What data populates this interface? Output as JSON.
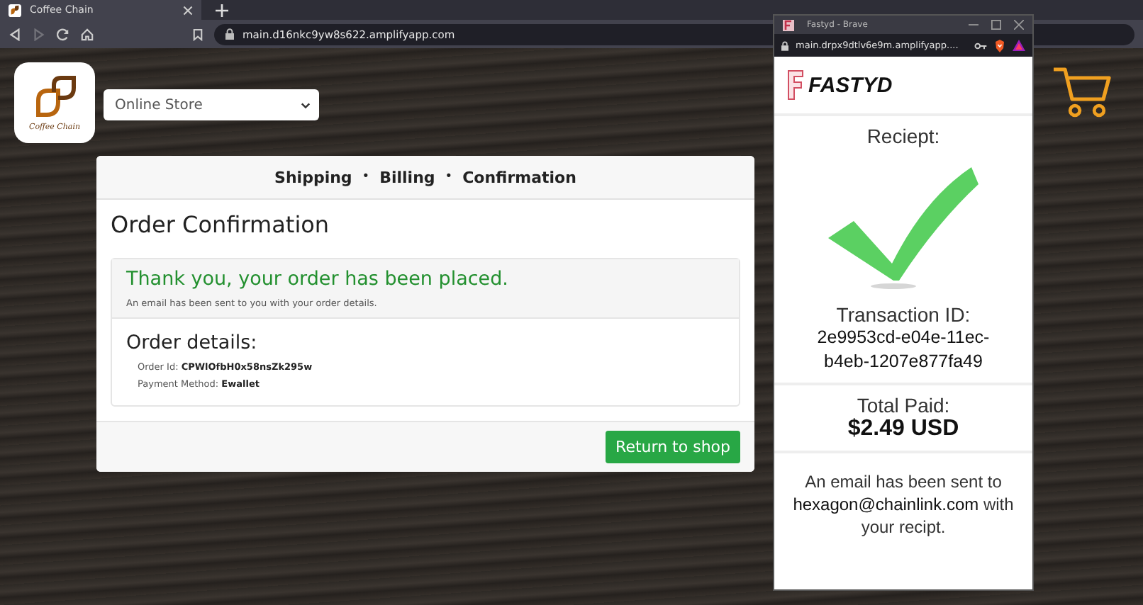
{
  "browser": {
    "tabs": [
      {
        "label": "Coffee Chain",
        "selected": true
      }
    ],
    "url": "main.d16nkc9yw8s622.amplifyapp.com",
    "forward_disabled": true
  },
  "page": {
    "logo_text": "Coffee Chain",
    "store_select": {
      "value": "Online Store"
    },
    "checkout": {
      "steps": [
        {
          "label": "Shipping"
        },
        {
          "label": "Billing"
        },
        {
          "label": "Confirmation"
        }
      ],
      "separator": "•",
      "title": "Order Confirmation",
      "success_title": "Thank you, your order has been placed.",
      "success_note": "An email has been sent to you with your order details.",
      "details_title": "Order details:",
      "details": [
        "Order Id: **CPWlOfbH0x58nsZk295w**",
        "Payment Method: **Ewallet**"
      ],
      "button": "Return to shop"
    }
  },
  "popup": {
    "title": "Fastyd - Brave",
    "url": "main.drpx9dtlv6e9m.amplifyapp....",
    "brand": "FASTYD",
    "receipt_label": "Reciept:",
    "transaction_label": "Transaction ID:",
    "transaction_id": "2e9953cd-e04e-11ec-b4eb-1207e877fa49",
    "total_label": "Total Paid:",
    "total": "$2.49 USD",
    "email_note": "An email has been sent to **hexagon@chainlink.com** with your recipt."
  }
}
